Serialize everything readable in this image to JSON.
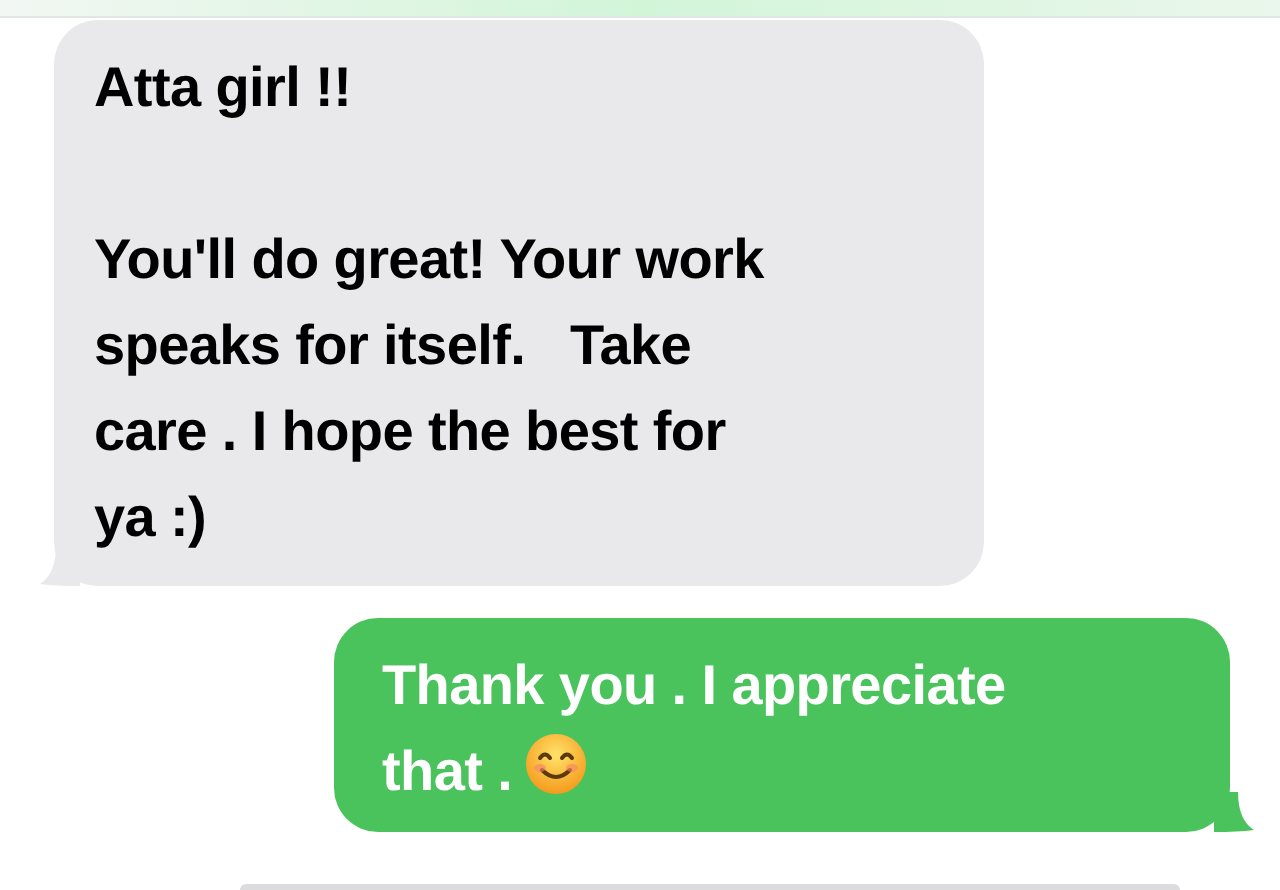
{
  "messages": [
    {
      "kind": "incoming",
      "paragraphs": [
        [
          "Atta girl !!"
        ],
        [
          "You'll do great! Your work",
          "speaks for itself.   Take",
          "care . I hope the best for",
          "ya :)"
        ]
      ]
    },
    {
      "kind": "outgoing",
      "paragraphs": [
        [
          "Thank you . I appreciate",
          "that ."
        ]
      ],
      "emoji": true
    }
  ]
}
